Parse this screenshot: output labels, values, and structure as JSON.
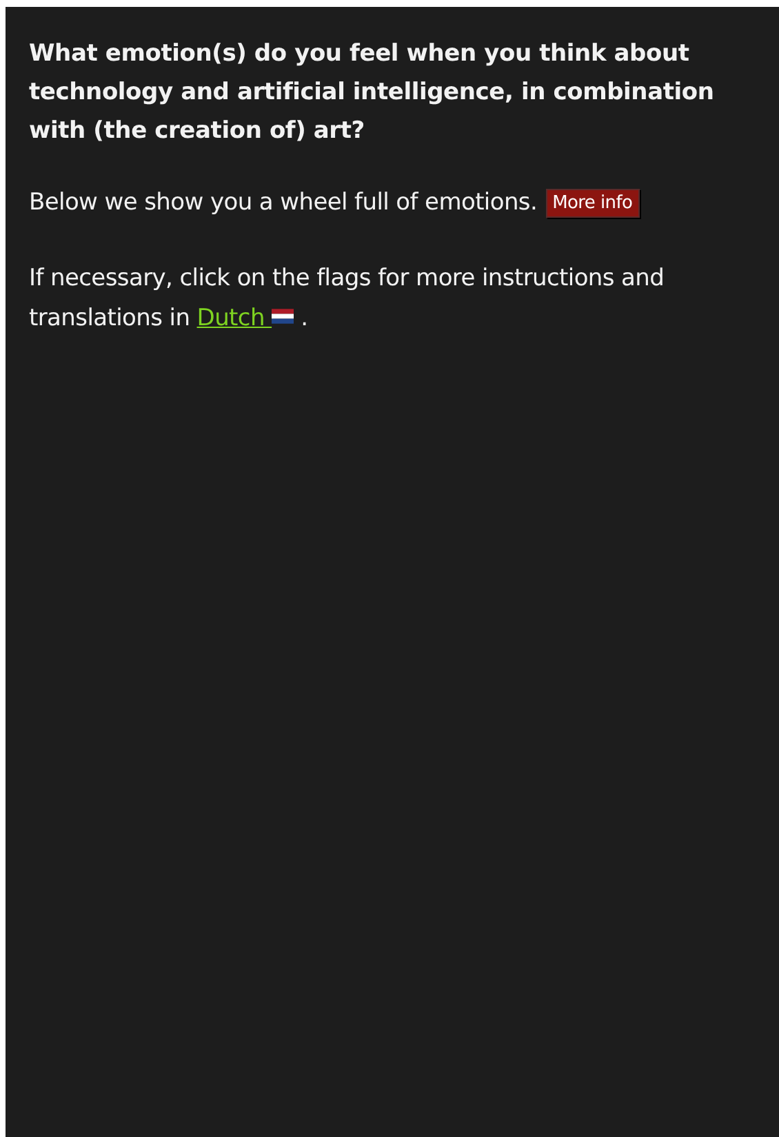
{
  "question": "What emotion(s) do you feel when you think about technology and artificial intelligence, in combination with (the creation of) art?",
  "intro": {
    "text": "Below we show you a wheel full of emotions.",
    "button": "More info"
  },
  "instructions": {
    "text_before": "If necessary, click on the flags for more instructions and translations in",
    "link": "Dutch",
    "text_after": "."
  }
}
